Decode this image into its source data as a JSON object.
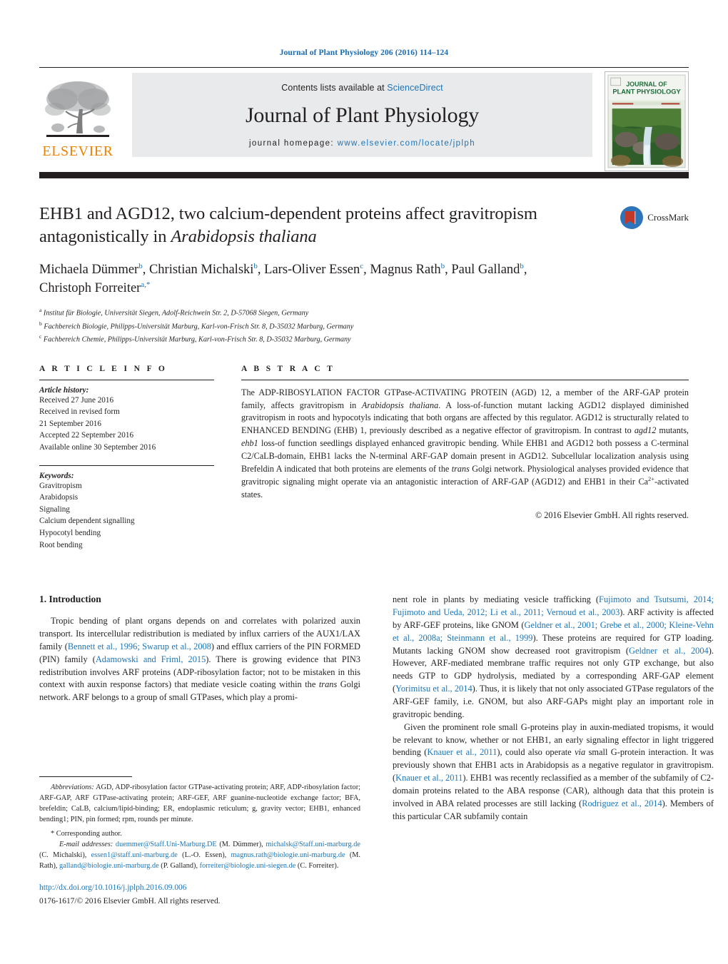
{
  "running_head": "Journal of Plant Physiology 206 (2016) 114–124",
  "masthead": {
    "contents_prefix": "Contents lists available at ",
    "sciencedirect": "ScienceDirect",
    "journal_title": "Journal of Plant Physiology",
    "homepage_label": "journal homepage: ",
    "homepage_url": "www.elsevier.com/locate/jplph",
    "publisher_wordmark": "ELSEVIER",
    "cover_line1": "JOURNAL OF",
    "cover_line2": "PLANT PHYSIOLOGY",
    "accent_blue": "#1a75bb",
    "elsevier_orange": "#F08000",
    "banner_bg": "#e9eaeb",
    "rule_dark": "#231f20"
  },
  "crossmark": {
    "label": "CrossMark"
  },
  "article": {
    "title_part1": "EHB1 and AGD12, two calcium-dependent proteins affect gravitropism antagonistically in ",
    "title_italic": "Arabidopsis thaliana",
    "authors": [
      {
        "name": "Michaela Dümmer",
        "sup": "b",
        "sep": ", "
      },
      {
        "name": "Christian Michalski",
        "sup": "b",
        "sep": ", "
      },
      {
        "name": "Lars-Oliver Essen",
        "sup": "c",
        "sep": ", "
      },
      {
        "name": "Magnus Rath",
        "sup": "b",
        "sep": ", "
      },
      {
        "name": "Paul Galland",
        "sup": "b",
        "sep": ", "
      },
      {
        "name": "Christoph Forreiter",
        "sup": "a,*",
        "sep": ""
      }
    ],
    "affiliations": [
      {
        "mark": "a",
        "text": "Institut für Biologie, Universität Siegen, Adolf-Reichwein Str. 2, D-57068 Siegen, Germany"
      },
      {
        "mark": "b",
        "text": "Fachbereich Biologie, Philipps-Universität Marburg, Karl-von-Frisch Str. 8, D-35032 Marburg, Germany"
      },
      {
        "mark": "c",
        "text": "Fachbereich Chemie, Philipps-Universität Marburg, Karl-von-Frisch Str. 8, D-35032 Marburg, Germany"
      }
    ]
  },
  "article_info": {
    "heading": "A R T I C L E   I N F O",
    "history_label": "Article history:",
    "history": [
      "Received 27 June 2016",
      "Received in revised form",
      "21 September 2016",
      "Accepted 22 September 2016",
      "Available online 30 September 2016"
    ],
    "keywords_label": "Keywords:",
    "keywords": [
      "Gravitropism",
      "Arabidopsis",
      "Signaling",
      "Calcium dependent signalling",
      "Hypocotyl bending",
      "Root bending"
    ]
  },
  "abstract": {
    "heading": "A B S T R A C T",
    "p1": "The ADP-RIBOSYLATION FACTOR GTPase-ACTIVATING PROTEIN (AGD) 12, a member of the ARF-GAP protein family, affects gravitropism in ",
    "italic1": "Arabidopsis thaliana",
    "p2": ". A loss-of-function mutant lacking AGD12 displayed diminished gravitropism in roots and hypocotyls indicating that both organs are affected by this regulator. AGD12 is structurally related to ENHANCED BENDING (EHB) 1, previously described as a negative effector of gravitropism. In contrast to ",
    "italic2": "agd12",
    "p3": " mutants, ",
    "italic3": "ehb1",
    "p4": " loss-of function seedlings displayed enhanced gravitropic bending. While EHB1 and AGD12 both possess a C-terminal C2/CaLB-domain, EHB1 lacks the N-terminal ARF-GAP domain present in AGD12. Subcellular localization analysis using Brefeldin A indicated that both proteins are elements of the ",
    "italic4": "trans",
    "p5": " Golgi network. Physiological analyses provided evidence that gravitropic signaling might operate via an antagonistic interaction of ARF-GAP (AGD12) and EHB1 in their Ca",
    "sup1": "2+",
    "p6": "-activated states.",
    "copyright": "© 2016 Elsevier GmbH. All rights reserved."
  },
  "introduction": {
    "heading": "1.  Introduction",
    "para1_a": "Tropic bending of plant organs depends on and correlates with polarized auxin transport. Its intercellular redistribution is mediated by influx carriers of the AUX1/LAX family (",
    "ref1": "Bennett et al., 1996; Swarup et al., 2008",
    "para1_b": ") and efflux carriers of the PIN FORMED (PIN) family (",
    "ref2": "Adamowski and Friml, 2015",
    "para1_c": "). There is growing evidence that PIN3 redistribution involves ARF proteins (ADP-ribosylation factor; not to be mistaken in this context with auxin response factors) that mediate vesicle coating within the ",
    "para1_ital": "trans",
    "para1_d": " Golgi network. ARF belongs to a group of small GTPases, which play a promi-"
  },
  "right_column": {
    "cont_a": "nent role in plants by mediating vesicle trafficking (",
    "ref3": "Fujimoto and Tsutsumi, 2014; Fujimoto and Ueda, 2012; Li et al., 2011; Vernoud et al., 2003",
    "cont_b": "). ARF activity is affected by ARF-GEF proteins, like GNOM (",
    "ref4": "Geldner et al., 2001; Grebe et al., 2000; Kleine-Vehn et al., 2008a; Steinmann et al., 1999",
    "cont_c": "). These proteins are required for GTP loading. Mutants lacking GNOM show decreased root gravitropism (",
    "ref5": "Geldner et al., 2004",
    "cont_d": "). However, ARF-mediated membrane traffic requires not only GTP exchange, but also needs GTP to GDP hydrolysis, mediated by a corresponding ARF-GAP element (",
    "ref6": "Yorimitsu et al., 2014",
    "cont_e": "). Thus, it is likely that not only associated GTPase regulators of the ARF-GEF family, i.e. GNOM, but also ARF-GAPs might play an important role in gravitropic bending.",
    "para2_a": "Given the prominent role small G-proteins play in auxin-mediated tropisms, it would be relevant to know, whether or not EHB1, an early signaling effector in light triggered bending (",
    "ref7": "Knauer et al., 2011",
    "para2_b": "), could also operate ",
    "para2_ital": "via",
    "para2_c": " small G-protein interaction. It was previously shown that EHB1 acts in Arabidopsis as a negative regulator in gravitropism. (",
    "ref8": "Knauer et al., 2011",
    "para2_d": "). EHB1 was recently reclassified as a member of the subfamily of C2-domain proteins related to the ABA response (CAR), although data that this protein is involved in ABA related processes are still lacking (",
    "ref9": "Rodriguez et al., 2014",
    "para2_e": "). Members of this particular CAR subfamily contain"
  },
  "footnotes": {
    "abbrev_label": "Abbreviations:",
    "abbrev_text": " AGD, ADP-ribosylation factor GTPase-activating protein; ARF, ADP-ribosylation factor; ARF-GAP, ARF GTPase-activating protein; ARF-GEF, ARF guanine-nucleotide exchange factor; BFA, brefeldin; CaLB, calcium/lipid-binding; ER, endoplasmic reticulum; g, gravity vector; EHB1, enhanced bending1; PIN, pin formed; rpm, rounds per minute.",
    "corresponding": "* Corresponding author.",
    "email_label": "E-mail addresses:",
    "emails": [
      {
        "addr": "duemmer@Staff.Uni-Marburg.DE",
        "who": " (M. Dümmer), "
      },
      {
        "addr": "michalsk@Staff.uni-marburg.de",
        "who": " (C. Michalski), "
      },
      {
        "addr": "essen1@staff.uni-marburg.de",
        "who": " (L.-O. Essen), "
      },
      {
        "addr": "magnus.rath@biologie.uni-marburg.de",
        "who": " (M. Rath), "
      },
      {
        "addr": "galland@biologie.uni-marburg.de",
        "who": " (P. Galland), "
      },
      {
        "addr": "forreiter@biologie.uni-siegen.de",
        "who": " (C. Forreiter)."
      }
    ],
    "doi": "http://dx.doi.org/10.1016/j.jplph.2016.09.006",
    "issn": "0176-1617/© 2016 Elsevier GmbH. All rights reserved."
  }
}
